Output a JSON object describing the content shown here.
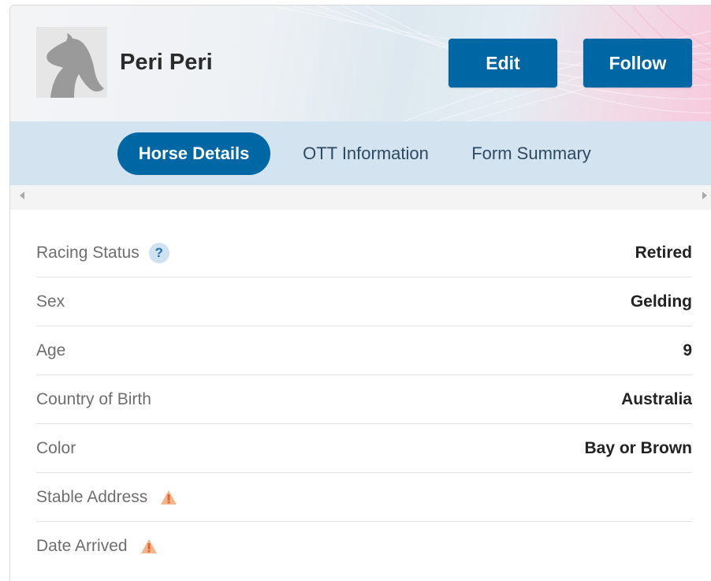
{
  "horse": {
    "name": "Peri Peri",
    "avatar_icon": "horse-silhouette-icon"
  },
  "actions": {
    "edit_label": "Edit",
    "follow_label": "Follow"
  },
  "tabs": [
    {
      "label": "Horse Details",
      "active": true
    },
    {
      "label": "OTT Information",
      "active": false
    },
    {
      "label": "Form Summary",
      "active": false
    }
  ],
  "details": [
    {
      "label": "Racing Status",
      "value": "Retired",
      "icon": "help-icon"
    },
    {
      "label": "Sex",
      "value": "Gelding"
    },
    {
      "label": "Age",
      "value": "9"
    },
    {
      "label": "Country of Birth",
      "value": "Australia"
    },
    {
      "label": "Color",
      "value": "Bay or Brown"
    },
    {
      "label": "Stable Address",
      "value": "",
      "icon": "warning-icon"
    },
    {
      "label": "Date Arrived",
      "value": "",
      "icon": "warning-icon"
    }
  ],
  "help_glyph": "?",
  "colors": {
    "primary": "#0067a5",
    "tab_bar": "#d3e3ef",
    "warning": "#e8622a"
  }
}
